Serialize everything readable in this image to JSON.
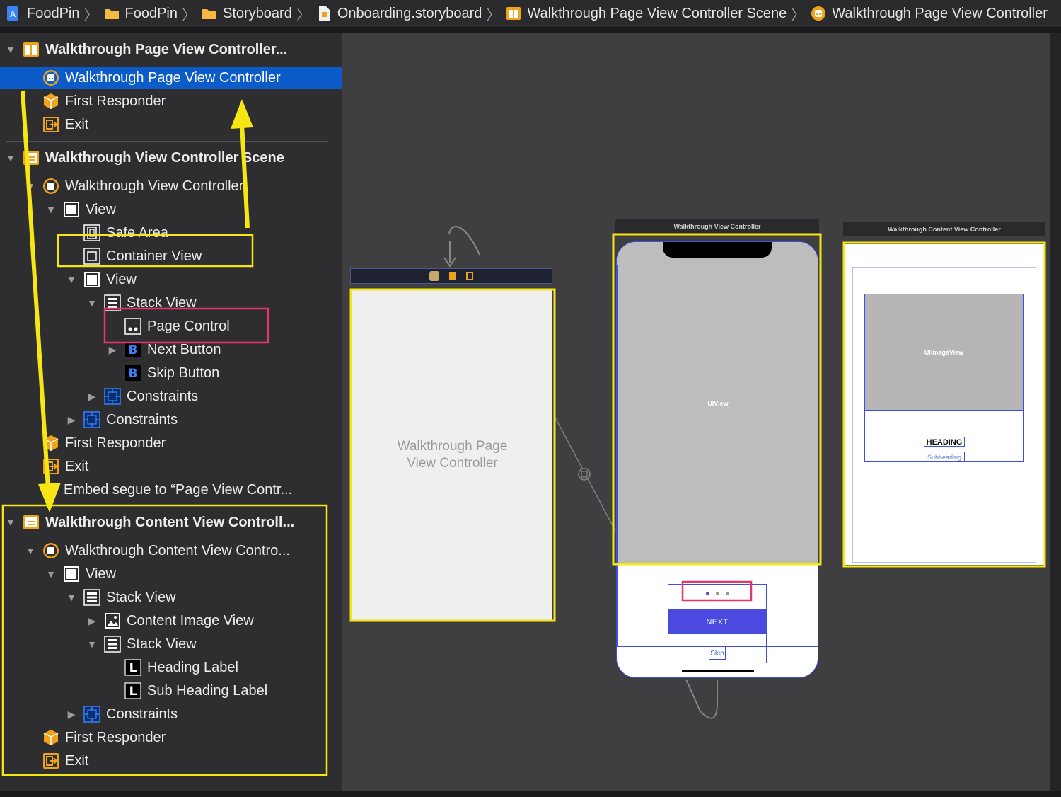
{
  "breadcrumb": [
    {
      "label": "FoodPin",
      "icon": "xcode-project-icon"
    },
    {
      "label": "FoodPin",
      "icon": "folder-icon"
    },
    {
      "label": "Storyboard",
      "icon": "folder-icon"
    },
    {
      "label": "Onboarding.storyboard",
      "icon": "storyboard-file-icon"
    },
    {
      "label": "Walkthrough Page View Controller Scene",
      "icon": "scene-icon"
    },
    {
      "label": "Walkthrough Page View Controller",
      "icon": "view-controller-icon"
    }
  ],
  "outline": {
    "scene1": {
      "title": "Walkthrough Page View Controller...",
      "items": [
        "Walkthrough Page View Controller",
        "First Responder",
        "Exit"
      ]
    },
    "scene2": {
      "title": "Walkthrough View Controller Scene",
      "vc": "Walkthrough View Controller",
      "view": "View",
      "safe_area": "Safe Area",
      "container_view": "Container View",
      "inner_view": "View",
      "stack_view": "Stack View",
      "page_control": "Page Control",
      "next_button": "Next Button",
      "skip_button": "Skip Button",
      "constraints_inner": "Constraints",
      "constraints_outer": "Constraints",
      "first_responder": "First Responder",
      "exit": "Exit",
      "embed_segue": "Embed segue to “Page View Contr..."
    },
    "scene3": {
      "title": "Walkthrough Content View Controll...",
      "vc": "Walkthrough Content View Contro...",
      "view": "View",
      "stack_view": "Stack View",
      "content_image_view": "Content Image View",
      "inner_stack_view": "Stack View",
      "heading_label": "Heading Label",
      "sub_heading_label": "Sub Heading Label",
      "constraints": "Constraints",
      "first_responder": "First Responder",
      "exit": "Exit"
    }
  },
  "canvas": {
    "page_vc_label": "Walkthrough Page View Controller",
    "walkthrough_vc_title": "Walkthrough View Controller",
    "uiview_label": "UIView",
    "next_label": "NEXT",
    "skip_label": "Skip",
    "content_vc_title": "Walkthrough Content View Controller",
    "uiimageview_label": "UIImageView",
    "heading_label": "HEADING",
    "subheading_label": "Subheading"
  },
  "colors": {
    "selection": "#0b5bc9",
    "annotation_yellow": "#f5e614",
    "annotation_pink": "#e7356d",
    "constraint_blue": "#3b4fe0",
    "orange_icon": "#f0a21a"
  }
}
